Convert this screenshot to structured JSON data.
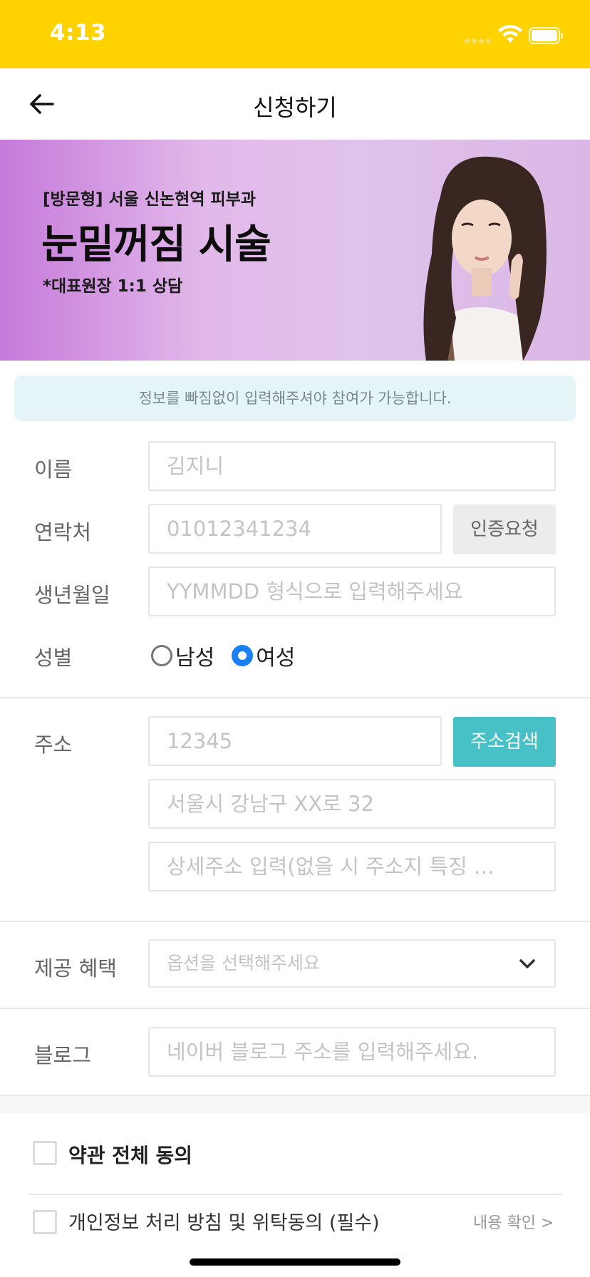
{
  "status_bar": {
    "time": "4:13",
    "background": "#FFD200",
    "icons": [
      "signal-icon",
      "wifi-icon",
      "battery-icon"
    ]
  },
  "header": {
    "title": "신청하기",
    "back_icon": "arrow-left-icon"
  },
  "banner": {
    "subtitle": "[방문형] 서울 신논현역 피부과",
    "title": "눈밑꺼짐 시술",
    "note": "*대표원장 1:1 상담"
  },
  "notice": {
    "text": "정보를 빠짐없이 입력해주셔야 참여가 가능합니다."
  },
  "form": {
    "name": {
      "label": "이름",
      "placeholder": "김지니"
    },
    "phone": {
      "label": "연락처",
      "placeholder": "01012341234",
      "button": "인증요청"
    },
    "birth": {
      "label": "생년월일",
      "placeholder": "YYMMDD 형식으로 입력해주세요"
    },
    "gender": {
      "label": "성별",
      "options": [
        "남성",
        "여성"
      ],
      "selected": "여성"
    },
    "address": {
      "label": "주소",
      "zip_placeholder": "12345",
      "search_button": "주소검색",
      "road_placeholder": "서울시 강남구 XX로 32",
      "detail_placeholder": "상세주소 입력(없을 시 주소지 특징 …"
    },
    "benefit": {
      "label": "제공 혜택",
      "placeholder": "옵션을 선택해주세요"
    },
    "blog": {
      "label": "블로그",
      "placeholder": "네이버 블로그 주소를 입력해주세요."
    }
  },
  "terms": {
    "agree_all": "약관 전체 동의",
    "privacy": "개인정보 처리 방침 및 위탁동의 (필수)",
    "view_link": "내용 확인 >"
  },
  "colors": {
    "accent_teal": "#47C1C6",
    "radio_blue": "#1A7FF2",
    "notice_bg": "#E5F4F6"
  }
}
